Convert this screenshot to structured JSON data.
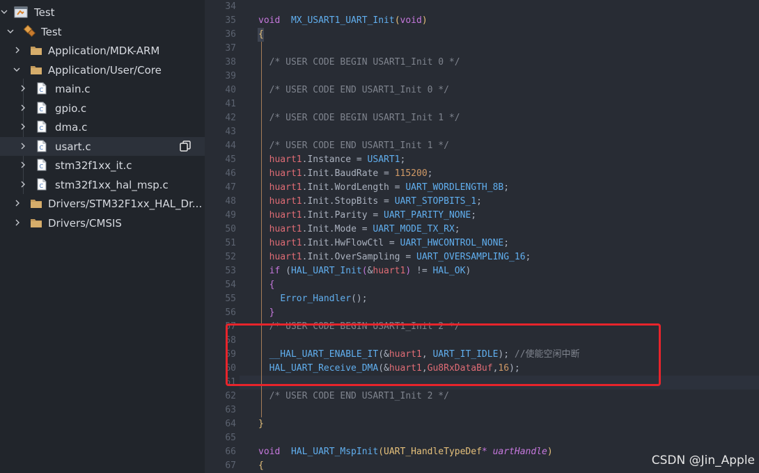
{
  "explorer": {
    "items": [
      {
        "label": "Test",
        "expanded": true,
        "icon": "workspace-icon"
      },
      {
        "label": "Test",
        "expanded": true,
        "icon": "project-icon"
      },
      {
        "label": "Application/MDK-ARM",
        "expanded": false,
        "icon": "folder-icon"
      },
      {
        "label": "Application/User/Core",
        "expanded": true,
        "icon": "folder-icon"
      },
      {
        "label": "main.c",
        "icon": "c-file-icon"
      },
      {
        "label": "gpio.c",
        "icon": "c-file-icon"
      },
      {
        "label": "dma.c",
        "icon": "c-file-icon"
      },
      {
        "label": "usart.c",
        "icon": "c-file-icon",
        "selected": true
      },
      {
        "label": "stm32f1xx_it.c",
        "icon": "c-file-icon"
      },
      {
        "label": "stm32f1xx_hal_msp.c",
        "icon": "c-file-icon"
      },
      {
        "label": "Drivers/STM32F1xx_HAL_Dr...",
        "expanded": false,
        "icon": "folder-icon"
      },
      {
        "label": "Drivers/CMSIS",
        "expanded": false,
        "icon": "folder-icon"
      }
    ]
  },
  "editor": {
    "line_numbers": [
      "34",
      "35",
      "36",
      "37",
      "38",
      "39",
      "40",
      "41",
      "42",
      "43",
      "44",
      "45",
      "46",
      "47",
      "48",
      "49",
      "50",
      "51",
      "52",
      "53",
      "54",
      "55",
      "56",
      "57",
      "58",
      "59",
      "60",
      "61",
      "62",
      "63",
      "64",
      "65",
      "66",
      "67"
    ],
    "lines": [
      [],
      [
        [
          "kw",
          "void"
        ],
        [
          "",
          "  "
        ],
        [
          "fn",
          "MX_USART1_UART_Init"
        ],
        [
          "ty",
          "("
        ],
        [
          "kw",
          "void"
        ],
        [
          "ty",
          ")"
        ]
      ],
      [
        [
          "ty",
          "{"
        ]
      ],
      [],
      [
        [
          "",
          "  "
        ],
        [
          "cmt",
          "/* USER CODE BEGIN USART1_Init 0 */"
        ]
      ],
      [],
      [
        [
          "",
          "  "
        ],
        [
          "cmt",
          "/* USER CODE END USART1_Init 0 */"
        ]
      ],
      [],
      [
        [
          "",
          "  "
        ],
        [
          "cmt",
          "/* USER CODE BEGIN USART1_Init 1 */"
        ]
      ],
      [],
      [
        [
          "",
          "  "
        ],
        [
          "cmt",
          "/* USER CODE END USART1_Init 1 */"
        ]
      ],
      [
        [
          "",
          "  "
        ],
        [
          "var",
          "huart1"
        ],
        [
          "",
          ".Instance = "
        ],
        [
          "fn",
          "USART1"
        ],
        [
          "",
          ";"
        ]
      ],
      [
        [
          "",
          "  "
        ],
        [
          "var",
          "huart1"
        ],
        [
          "",
          ".Init.BaudRate = "
        ],
        [
          "num",
          "115200"
        ],
        [
          "",
          ";"
        ]
      ],
      [
        [
          "",
          "  "
        ],
        [
          "var",
          "huart1"
        ],
        [
          "",
          ".Init.WordLength = "
        ],
        [
          "fn",
          "UART_WORDLENGTH_8B"
        ],
        [
          "",
          ";"
        ]
      ],
      [
        [
          "",
          "  "
        ],
        [
          "var",
          "huart1"
        ],
        [
          "",
          ".Init.StopBits = "
        ],
        [
          "fn",
          "UART_STOPBITS_1"
        ],
        [
          "",
          ";"
        ]
      ],
      [
        [
          "",
          "  "
        ],
        [
          "var",
          "huart1"
        ],
        [
          "",
          ".Init.Parity = "
        ],
        [
          "fn",
          "UART_PARITY_NONE"
        ],
        [
          "",
          ";"
        ]
      ],
      [
        [
          "",
          "  "
        ],
        [
          "var",
          "huart1"
        ],
        [
          "",
          ".Init.Mode = "
        ],
        [
          "fn",
          "UART_MODE_TX_RX"
        ],
        [
          "",
          ";"
        ]
      ],
      [
        [
          "",
          "  "
        ],
        [
          "var",
          "huart1"
        ],
        [
          "",
          ".Init.HwFlowCtl = "
        ],
        [
          "fn",
          "UART_HWCONTROL_NONE"
        ],
        [
          "",
          ";"
        ]
      ],
      [
        [
          "",
          "  "
        ],
        [
          "var",
          "huart1"
        ],
        [
          "",
          ".Init.OverSampling = "
        ],
        [
          "fn",
          "UART_OVERSAMPLING_16"
        ],
        [
          "",
          ";"
        ]
      ],
      [
        [
          "",
          "  "
        ],
        [
          "kw",
          "if"
        ],
        [
          "",
          " ("
        ],
        [
          "fn",
          "HAL_UART_Init"
        ],
        [
          "kw",
          "("
        ],
        [
          "",
          "&"
        ],
        [
          "var",
          "huart1"
        ],
        [
          "kw",
          ")"
        ],
        [
          "",
          " != "
        ],
        [
          "fn",
          "HAL_OK"
        ],
        [
          "",
          ")"
        ]
      ],
      [
        [
          "",
          "  "
        ],
        [
          "kw",
          "{"
        ]
      ],
      [
        [
          "",
          "    "
        ],
        [
          "fn",
          "Error_Handler"
        ],
        [
          "",
          "();"
        ]
      ],
      [
        [
          "",
          "  "
        ],
        [
          "kw",
          "}"
        ]
      ],
      [
        [
          "",
          "  "
        ],
        [
          "cmt",
          "/* USER CODE BEGIN USART1_Init 2 */"
        ]
      ],
      [],
      [
        [
          "",
          "  "
        ],
        [
          "fn",
          "__HAL_UART_ENABLE_IT"
        ],
        [
          "",
          "(&"
        ],
        [
          "var",
          "huart1"
        ],
        [
          "",
          ", "
        ],
        [
          "fn",
          "UART_IT_IDLE"
        ],
        [
          "",
          "); "
        ],
        [
          "cmt",
          "//使能空闲中断"
        ]
      ],
      [
        [
          "",
          "  "
        ],
        [
          "fn",
          "HAL_UART_Receive_DMA"
        ],
        [
          "",
          "(&"
        ],
        [
          "var",
          "huart1"
        ],
        [
          "",
          ","
        ],
        [
          "var",
          "Gu8RxDataBuf"
        ],
        [
          "",
          ","
        ],
        [
          "num",
          "16"
        ],
        [
          "",
          ");"
        ]
      ],
      [],
      [
        [
          "",
          "  "
        ],
        [
          "cmt",
          "/* USER CODE END USART1_Init 2 */"
        ]
      ],
      [],
      [
        [
          "ty",
          "}"
        ]
      ],
      [],
      [
        [
          "kw",
          "void"
        ],
        [
          "",
          "  "
        ],
        [
          "fn",
          "HAL_UART_MspInit"
        ],
        [
          "ty",
          "("
        ],
        [
          "ty",
          "UART_HandleTypeDef"
        ],
        [
          "kw",
          "*"
        ],
        [
          "",
          " "
        ],
        [
          "par",
          "uartHandle"
        ],
        [
          "ty",
          ")"
        ]
      ],
      [
        [
          "ty",
          "{"
        ]
      ]
    ]
  },
  "watermark": "CSDN @Jin_Apple",
  "colors": {
    "highlight_box": "#e8242b",
    "background": "#282c34",
    "sidebar": "#21252b"
  }
}
